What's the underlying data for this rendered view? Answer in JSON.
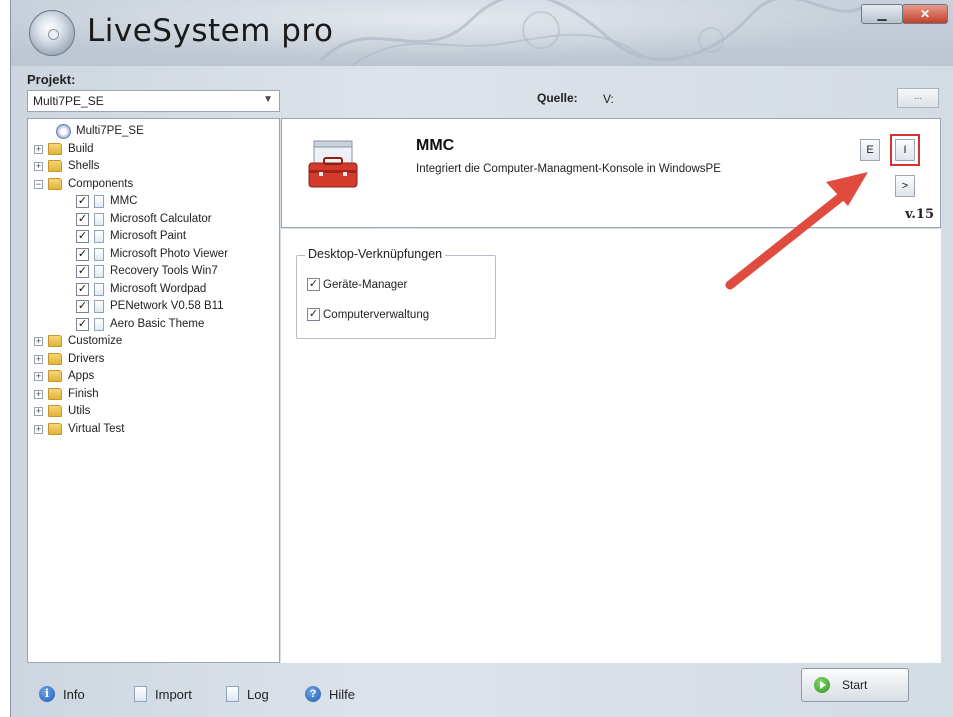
{
  "app": {
    "title": "LiveSystem pro"
  },
  "project": {
    "label": "Projekt:",
    "selected": "Multi7PE_SE"
  },
  "tree": {
    "root": "Multi7PE_SE",
    "folders_top": [
      "Build",
      "Shells"
    ],
    "components_label": "Components",
    "components": [
      "MMC",
      "Microsoft Calculator",
      "Microsoft Paint",
      "Microsoft Photo Viewer",
      "Recovery Tools Win7",
      "Microsoft Wordpad",
      "PENetwork V0.58 B11",
      "Aero Basic Theme"
    ],
    "folders_bottom": [
      "Customize",
      "Drivers",
      "Apps",
      "Finish",
      "Utils",
      "Virtual Test"
    ]
  },
  "source": {
    "label": "Quelle:",
    "value": "V:",
    "browse": "..."
  },
  "module": {
    "name": "MMC",
    "description": "Integriert die Computer-Managment-Konsole in WindowsPE",
    "btn_e": "E",
    "btn_i": "I",
    "btn_next": ">",
    "version": "v.15"
  },
  "shortcuts": {
    "title": "Desktop-Verknüpfungen",
    "items": [
      {
        "label": "Geräte-Manager",
        "checked": true
      },
      {
        "label": "Computerverwaltung",
        "checked": true
      }
    ]
  },
  "footer": {
    "info": "Info",
    "import": "Import",
    "log": "Log",
    "help": "Hilfe",
    "start": "Start"
  },
  "colors": {
    "highlight": "#d73232",
    "arrow": "#e04b3f"
  }
}
